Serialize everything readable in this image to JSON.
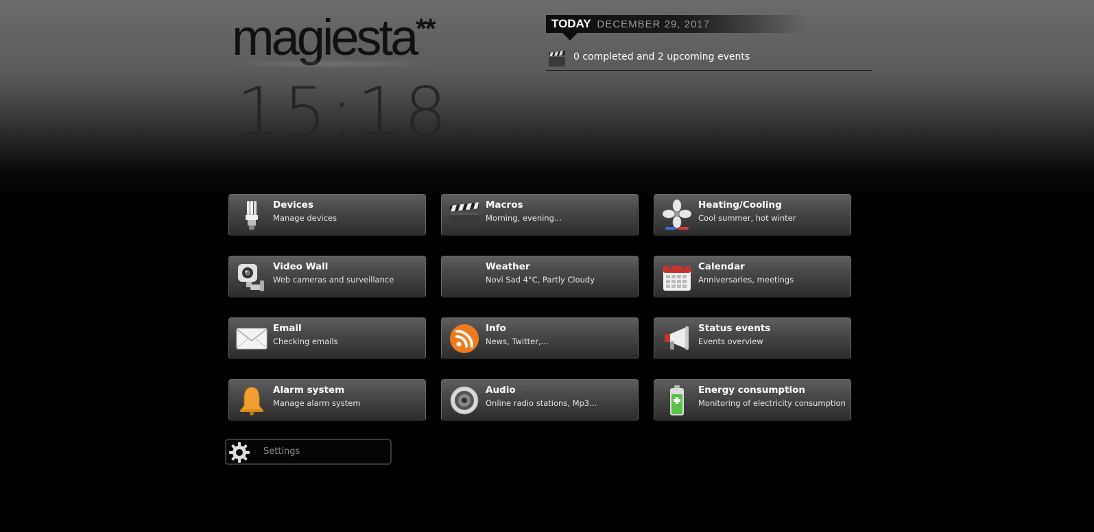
{
  "header": {
    "logo_text": "magiesta",
    "logo_stars": "**",
    "clock": "15:18"
  },
  "today": {
    "label": "TODAY",
    "date": "DECEMBER 29, 2017",
    "events_text": "0 completed and 2 upcoming events"
  },
  "tiles": [
    {
      "title": "Devices",
      "subtitle": "Manage devices",
      "icon": "lightbulb-icon"
    },
    {
      "title": "Macros",
      "subtitle": "Morning, evening...",
      "icon": "clapperboard-icon"
    },
    {
      "title": "Heating/Cooling",
      "subtitle": "Cool summer, hot winter",
      "icon": "fan-icon"
    },
    {
      "title": "Video Wall",
      "subtitle": "Web cameras and surveillance",
      "icon": "camera-icon"
    },
    {
      "title": "Weather",
      "subtitle": "Novi Sad 4°C, Partly Cloudy",
      "icon": ""
    },
    {
      "title": "Calendar",
      "subtitle": "Anniversaries, meetings",
      "icon": "calendar-icon"
    },
    {
      "title": "Email",
      "subtitle": "Checking emails",
      "icon": "envelope-icon"
    },
    {
      "title": "Info",
      "subtitle": "News, Twitter,...",
      "icon": "rss-icon"
    },
    {
      "title": "Status events",
      "subtitle": "Events overview",
      "icon": "megaphone-icon"
    },
    {
      "title": "Alarm system",
      "subtitle": "Manage alarm system",
      "icon": "bell-icon"
    },
    {
      "title": "Audio",
      "subtitle": "Online radio stations, Mp3...",
      "icon": "speaker-icon"
    },
    {
      "title": "Energy consumption",
      "subtitle": "Monitoring of electricity consumption",
      "icon": "battery-icon"
    }
  ],
  "settings": {
    "label": "Settings",
    "icon": "gear-icon"
  }
}
